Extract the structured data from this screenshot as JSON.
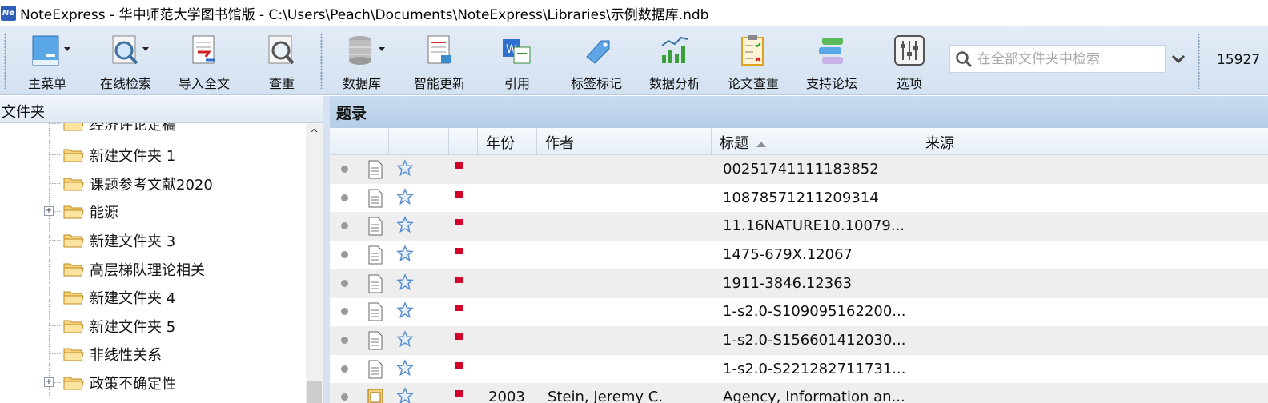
{
  "window": {
    "app_icon_text": "Ne",
    "title": "NoteExpress - 华中师范大学图书馆版 - C:\\Users\\Peach\\Documents\\NoteExpress\\Libraries\\示例数据库.ndb"
  },
  "toolbar": {
    "items": [
      {
        "label": "主菜单",
        "icon": "main-menu-icon"
      },
      {
        "label": "在线检索",
        "icon": "online-search-icon"
      },
      {
        "label": "导入全文",
        "icon": "import-fulltext-icon"
      },
      {
        "label": "查重",
        "icon": "duplicate-check-icon"
      },
      {
        "label": "数据库",
        "icon": "database-icon"
      },
      {
        "label": "智能更新",
        "icon": "smart-update-icon"
      },
      {
        "label": "引用",
        "icon": "cite-icon"
      },
      {
        "label": "标签标记",
        "icon": "tag-icon"
      },
      {
        "label": "数据分析",
        "icon": "data-analysis-icon"
      },
      {
        "label": "论文查重",
        "icon": "paper-check-icon"
      },
      {
        "label": "支持论坛",
        "icon": "forum-icon"
      },
      {
        "label": "选项",
        "icon": "options-icon"
      }
    ],
    "search_placeholder": "在全部文件夹中检索",
    "count_text": "15927"
  },
  "folders": {
    "header": "文件夹",
    "items": [
      {
        "name": "经济评论定稿",
        "expandable": false
      },
      {
        "name": "新建文件夹 1",
        "expandable": false
      },
      {
        "name": "课题参考文献2020",
        "expandable": false
      },
      {
        "name": "能源",
        "expandable": true
      },
      {
        "name": "新建文件夹 3",
        "expandable": false
      },
      {
        "name": "高层梯队理论相关",
        "expandable": false
      },
      {
        "name": "新建文件夹 4",
        "expandable": false
      },
      {
        "name": "新建文件夹 5",
        "expandable": false
      },
      {
        "name": "非线性关系",
        "expandable": false
      },
      {
        "name": "政策不确定性",
        "expandable": true
      }
    ]
  },
  "records": {
    "header": "题录",
    "columns": {
      "year": "年份",
      "author": "作者",
      "title": "标题",
      "source": "来源"
    },
    "rows": [
      {
        "year": "",
        "author": "",
        "title": "00251741111183852"
      },
      {
        "year": "",
        "author": "",
        "title": "10878571211209314"
      },
      {
        "year": "",
        "author": "",
        "title": "11.16NATURE10.10079..."
      },
      {
        "year": "",
        "author": "",
        "title": "1475-679X.12067"
      },
      {
        "year": "",
        "author": "",
        "title": "1911-3846.12363"
      },
      {
        "year": "",
        "author": "",
        "title": "1-s2.0-S109095162200..."
      },
      {
        "year": "",
        "author": "",
        "title": "1-s2.0-S156601412030..."
      },
      {
        "year": "",
        "author": "",
        "title": "1-s2.0-S221282711731..."
      },
      {
        "year": "2003",
        "author": "Stein, Jeremy C.",
        "title": "Agency, Information an..."
      }
    ]
  },
  "colors": {
    "flag": "#d0002a",
    "toolbar_bg": "#dbe6f4",
    "header_bg": "#bfd3ec"
  }
}
